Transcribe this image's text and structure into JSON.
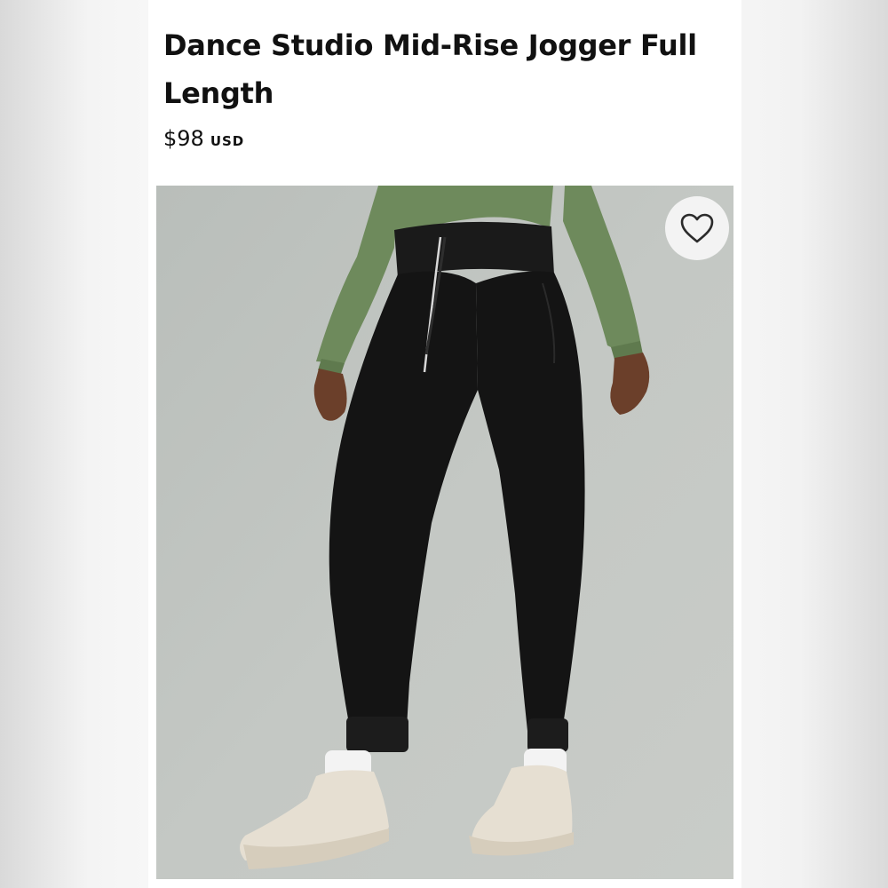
{
  "product": {
    "title": "Dance Studio Mid-Rise Jogger Full Length",
    "price": "$98",
    "currency": "USD"
  },
  "image": {
    "subject": "product-photo-black-joggers",
    "favorite_icon": "heart-outline-icon",
    "colors": {
      "background": "#bfc3c0",
      "top": "#6e8a5c",
      "pants": "#141414",
      "socks": "#f3f3f3",
      "shoes": "#e6dfd2"
    }
  }
}
